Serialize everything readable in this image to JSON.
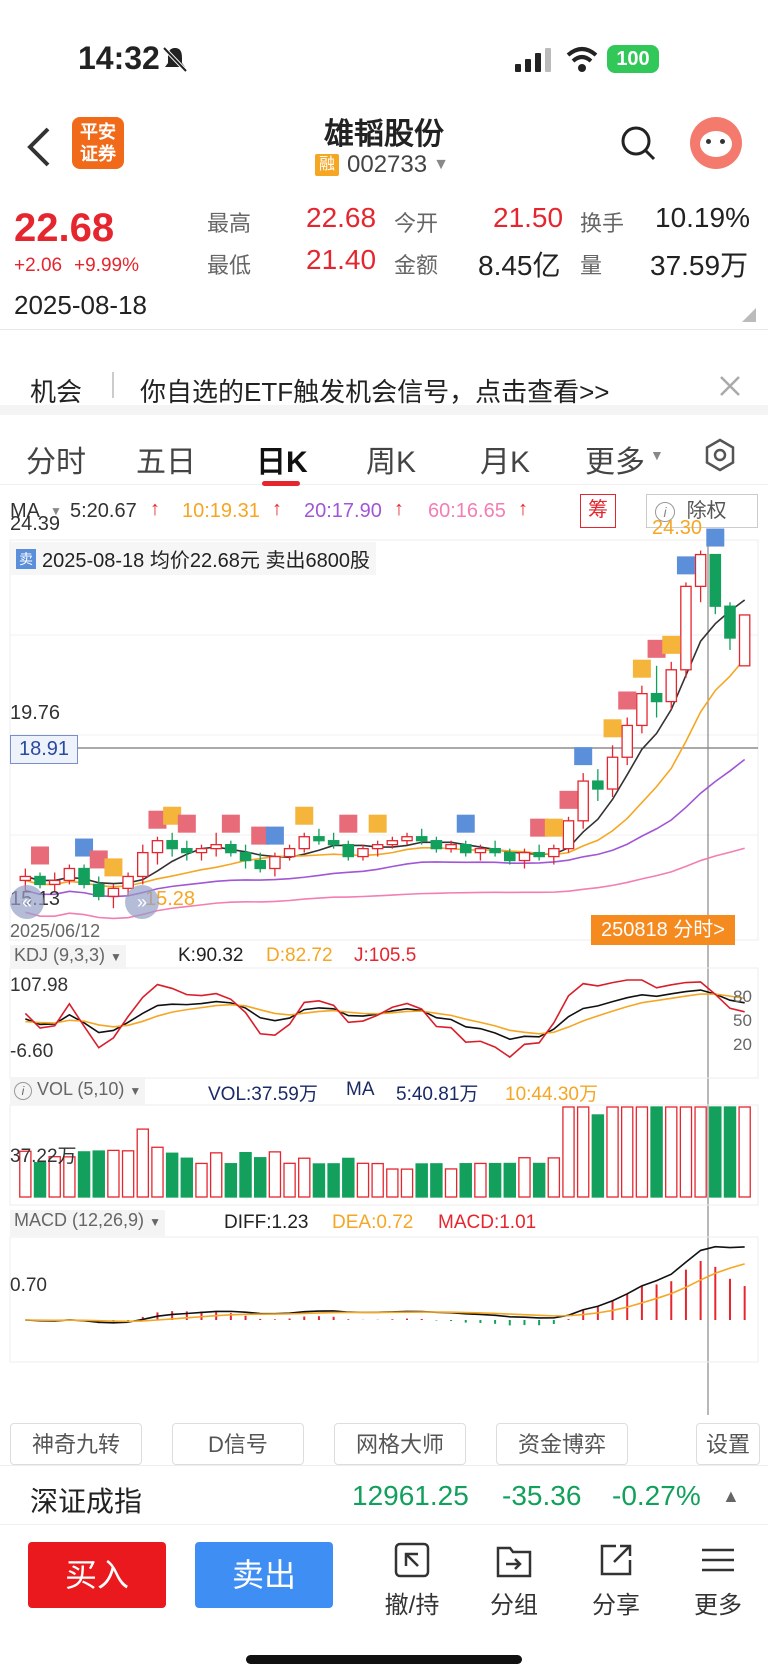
{
  "status": {
    "time": "14:32",
    "battery": "100"
  },
  "header": {
    "title": "雄韬股份",
    "tag": "融",
    "code": "002733",
    "logo": "平安证券"
  },
  "quote": {
    "price": "22.68",
    "change": "+2.06",
    "pct": "+9.99%",
    "date": "2025-08-18",
    "high_label": "最高",
    "high": "22.68",
    "open_label": "今开",
    "open": "21.50",
    "turnover_label": "换手",
    "turnover": "10.19%",
    "low_label": "最低",
    "low": "21.40",
    "amount_label": "金额",
    "amount": "8.45亿",
    "vol_label": "量",
    "vol": "37.59万"
  },
  "banner": {
    "label": "机会",
    "text": "你自选的ETF触发机会信号，点击查看>>"
  },
  "tabs": {
    "t1": "分时",
    "t2": "五日",
    "t3": "日K",
    "t4": "周K",
    "t5": "月K",
    "t6": "更多"
  },
  "ma": {
    "label": "MA",
    "ma5": "5:20.67",
    "ma10": "10:19.31",
    "ma20": "20:17.90",
    "ma60": "60:16.65",
    "chip": "筹",
    "adjust": "除权"
  },
  "kchart": {
    "high_axis": "24.39",
    "mid_axis": "19.76",
    "cursor": "18.91",
    "low_axis": "15.13",
    "peak_label": "24.30",
    "low_label": "15.28",
    "trade_note_tag": "卖",
    "trade_note": "2025-08-18 均价22.68元 卖出6800股",
    "start_date": "2025/06/12",
    "intraday_btn": "250818 分时>"
  },
  "kdj": {
    "label": "KDJ (9,3,3)",
    "k": "K:90.32",
    "d": "D:82.72",
    "j": "J:105.5",
    "top": "107.98",
    "bottom": "-6.60",
    "r80": "80",
    "r50": "50",
    "r20": "20"
  },
  "vol": {
    "label": "VOL (5,10)",
    "vol": "VOL:37.59万",
    "ma_label": "MA",
    "ma5": "5:40.81万",
    "ma10": "10:44.30万",
    "axis": "37.22万"
  },
  "macd": {
    "label": "MACD (12,26,9)",
    "diff": "DIFF:1.23",
    "dea": "DEA:0.72",
    "macd": "MACD:1.01",
    "axis": "0.70"
  },
  "tools": [
    "神奇九转",
    "D信号",
    "网格大师",
    "资金博弈",
    "设置"
  ],
  "index": {
    "name": "深证成指",
    "value": "12961.25",
    "change": "-35.36",
    "pct": "-0.27%"
  },
  "bottom": {
    "buy": "买入",
    "sell": "卖出",
    "cancel": "撤/持",
    "group": "分组",
    "share": "分享",
    "more": "更多"
  },
  "chart_data": [
    {
      "type": "candlestick",
      "title": "日K",
      "x_start": "2025/06/12",
      "x_end": "2025-08-18",
      "y_axis_labels": [
        "24.39",
        "19.76",
        "15.13"
      ],
      "marked": {
        "max": 24.3,
        "min": 15.28,
        "cursor": 18.91
      },
      "candles": [
        [
          16.0,
          16.3,
          15.7,
          16.1
        ],
        [
          16.1,
          16.2,
          15.8,
          15.9
        ],
        [
          15.9,
          16.2,
          15.7,
          16.0
        ],
        [
          16.0,
          16.4,
          15.9,
          16.3
        ],
        [
          16.3,
          16.4,
          15.8,
          15.9
        ],
        [
          15.9,
          16.1,
          15.5,
          15.6
        ],
        [
          15.6,
          15.9,
          15.3,
          15.8
        ],
        [
          15.8,
          16.2,
          15.6,
          16.1
        ],
        [
          16.1,
          16.9,
          15.9,
          16.7
        ],
        [
          16.7,
          17.1,
          16.4,
          17.0
        ],
        [
          17.0,
          17.2,
          16.6,
          16.8
        ],
        [
          16.8,
          17.0,
          16.5,
          16.7
        ],
        [
          16.7,
          16.9,
          16.5,
          16.8
        ],
        [
          16.8,
          17.2,
          16.6,
          16.9
        ],
        [
          16.9,
          17.0,
          16.6,
          16.7
        ],
        [
          16.7,
          16.9,
          16.3,
          16.5
        ],
        [
          16.5,
          16.7,
          16.2,
          16.3
        ],
        [
          16.3,
          16.7,
          16.1,
          16.6
        ],
        [
          16.6,
          16.9,
          16.5,
          16.8
        ],
        [
          16.8,
          17.2,
          16.7,
          17.1
        ],
        [
          17.1,
          17.3,
          16.9,
          17.0
        ],
        [
          17.0,
          17.2,
          16.8,
          16.9
        ],
        [
          16.9,
          17.0,
          16.5,
          16.6
        ],
        [
          16.6,
          16.9,
          16.5,
          16.8
        ],
        [
          16.8,
          17.0,
          16.6,
          16.9
        ],
        [
          16.9,
          17.1,
          16.8,
          17.0
        ],
        [
          17.0,
          17.2,
          16.9,
          17.1
        ],
        [
          17.1,
          17.3,
          16.9,
          17.0
        ],
        [
          17.0,
          17.1,
          16.7,
          16.8
        ],
        [
          16.8,
          17.0,
          16.7,
          16.9
        ],
        [
          16.9,
          17.0,
          16.6,
          16.7
        ],
        [
          16.7,
          16.9,
          16.5,
          16.8
        ],
        [
          16.8,
          17.0,
          16.6,
          16.7
        ],
        [
          16.7,
          16.8,
          16.4,
          16.5
        ],
        [
          16.5,
          16.8,
          16.3,
          16.7
        ],
        [
          16.7,
          16.9,
          16.5,
          16.6
        ],
        [
          16.6,
          16.9,
          16.4,
          16.8
        ],
        [
          16.8,
          17.6,
          16.7,
          17.5
        ],
        [
          17.5,
          18.7,
          17.3,
          18.5
        ],
        [
          18.5,
          18.8,
          18.0,
          18.3
        ],
        [
          18.3,
          19.4,
          18.1,
          19.1
        ],
        [
          19.1,
          20.1,
          18.9,
          19.9
        ],
        [
          19.9,
          20.9,
          19.7,
          20.7
        ],
        [
          20.7,
          21.4,
          20.1,
          20.5
        ],
        [
          20.5,
          21.5,
          20.3,
          21.3
        ],
        [
          21.3,
          23.5,
          21.1,
          23.4
        ],
        [
          23.4,
          24.3,
          23.0,
          24.2
        ],
        [
          24.2,
          24.2,
          22.7,
          22.9
        ],
        [
          22.9,
          23.0,
          21.8,
          22.1
        ],
        [
          21.4,
          22.68,
          21.4,
          22.68
        ]
      ]
    },
    {
      "type": "line",
      "title": "KDJ (9,3,3)",
      "y_axis_labels": [
        "107.98",
        "-6.60"
      ],
      "series": [
        {
          "name": "K",
          "last": 90.32
        },
        {
          "name": "D",
          "last": 82.72
        },
        {
          "name": "J",
          "last": 105.5
        }
      ]
    },
    {
      "type": "bar",
      "title": "VOL (5,10)",
      "y_axis_labels": [
        "37.22万"
      ],
      "series": [
        {
          "name": "VOL",
          "last": "37.59万"
        },
        {
          "name": "MA5",
          "last": "40.81万"
        },
        {
          "name": "MA10",
          "last": "44.30万"
        }
      ]
    },
    {
      "type": "bar",
      "title": "MACD (12,26,9)",
      "y_axis_labels": [
        "0.70"
      ],
      "series": [
        {
          "name": "DIFF",
          "last": 1.23
        },
        {
          "name": "DEA",
          "last": 0.72
        },
        {
          "name": "MACD",
          "last": 1.01
        }
      ]
    }
  ]
}
